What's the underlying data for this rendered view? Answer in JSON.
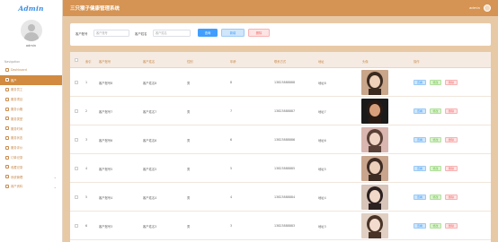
{
  "brand": {
    "logo_text": "Admin"
  },
  "user": {
    "name": "admin"
  },
  "sidebar": {
    "nav_title": "Navigation",
    "items": [
      {
        "label": "Dashboard"
      },
      {
        "label": "客户"
      },
      {
        "label": "服务员工"
      },
      {
        "label": "服务项目"
      },
      {
        "label": "服务价格"
      },
      {
        "label": "服务类型"
      },
      {
        "label": "服务时间"
      },
      {
        "label": "服务状态"
      },
      {
        "label": "服务评价"
      },
      {
        "label": "订单记录"
      },
      {
        "label": "收藏记录"
      },
      {
        "label": "系统管理"
      },
      {
        "label": "用户资料"
      }
    ]
  },
  "header": {
    "title": "三只猴子健康管理系统",
    "admin_label": "admin"
  },
  "search": {
    "field1_label": "客户账号",
    "field1_placeholder": "客户账号",
    "field2_label": "客户姓名",
    "field2_placeholder": "客户姓名",
    "query_label": "查询",
    "add_label": "新增",
    "delete_label": "删除"
  },
  "table": {
    "columns": [
      "索引",
      "客户账号",
      "客户姓名",
      "性别",
      "年龄",
      "联系方式",
      "地址",
      "头像",
      "操作"
    ],
    "actions": {
      "view": "查看",
      "edit": "修改",
      "delete": "删除"
    },
    "rows": [
      {
        "index": "1",
        "account": "客户账号8",
        "name": "客户姓名8",
        "gender": "男",
        "age": "8",
        "phone": "13823888888",
        "address": "地址8"
      },
      {
        "index": "2",
        "account": "客户账号7",
        "name": "客户姓名7",
        "gender": "男",
        "age": "7",
        "phone": "13823888887",
        "address": "地址7"
      },
      {
        "index": "3",
        "account": "客户账号6",
        "name": "客户姓名6",
        "gender": "男",
        "age": "6",
        "phone": "13823888886",
        "address": "地址6"
      },
      {
        "index": "4",
        "account": "客户账号5",
        "name": "客户姓名5",
        "gender": "男",
        "age": "5",
        "phone": "13823888885",
        "address": "地址5"
      },
      {
        "index": "5",
        "account": "客户账号4",
        "name": "客户姓名4",
        "gender": "男",
        "age": "4",
        "phone": "13823888884",
        "address": "地址4"
      },
      {
        "index": "6",
        "account": "客户账号3",
        "name": "客户姓名3",
        "gender": "男",
        "age": "3",
        "phone": "13823888883",
        "address": "地址3"
      }
    ]
  },
  "colors": {
    "accent": "#d59453",
    "primary": "#409eff",
    "success": "#67c23a",
    "danger": "#f56c6c"
  }
}
